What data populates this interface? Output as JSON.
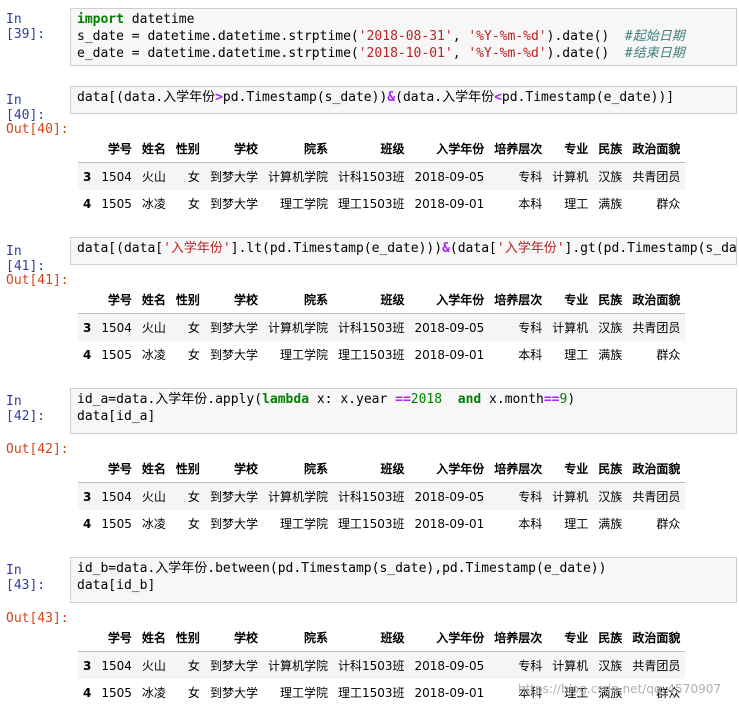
{
  "cells": [
    {
      "in_prompt": "In [39]:",
      "code_lines": [
        "import datetime",
        "s_date = datetime.datetime.strptime('2018-08-31', '%Y-%m-%d').date()  #起始日期",
        "e_date = datetime.datetime.strptime('2018-10-01', '%Y-%m-%d').date()  #结束日期"
      ]
    },
    {
      "in_prompt": "In [40]:",
      "out_prompt": "Out[40]:",
      "code_lines": [
        "data[(data.入学年份>pd.Timestamp(s_date))&(data.入学年份<pd.Timestamp(e_date))]"
      ]
    },
    {
      "in_prompt": "In [41]:",
      "out_prompt": "Out[41]:",
      "code_lines": [
        "data[(data['入学年份'].lt(pd.Timestamp(e_date)))&(data['入学年份'].gt(pd.Timestamp(s_date)"
      ]
    },
    {
      "in_prompt": "In [42]:",
      "out_prompt": "Out[42]:",
      "code_lines": [
        "id_a=data.入学年份.apply(lambda x: x.year ==2018  and x.month==9)",
        "data[id_a]"
      ]
    },
    {
      "in_prompt": "In [43]:",
      "out_prompt": "Out[43]:",
      "code_lines": [
        "id_b=data.入学年份.between(pd.Timestamp(s_date),pd.Timestamp(e_date))",
        "data[id_b]"
      ]
    }
  ],
  "table": {
    "columns": [
      "学号",
      "姓名",
      "性别",
      "学校",
      "院系",
      "班级",
      "入学年份",
      "培养层次",
      "专业",
      "民族",
      "政治面貌"
    ],
    "rows": [
      {
        "index": "3",
        "values": [
          "1504",
          "火山",
          "女",
          "到梦大学",
          "计算机学院",
          "计科1503班",
          "2018-09-05",
          "专科",
          "计算机",
          "汉族",
          "共青团员"
        ]
      },
      {
        "index": "4",
        "values": [
          "1505",
          "冰凌",
          "女",
          "到梦大学",
          "理工学院",
          "理工1503班",
          "2018-09-01",
          "本科",
          "理工",
          "满族",
          "群众"
        ]
      }
    ]
  },
  "watermark": "https://blog.csdn.net/qq_4570907"
}
